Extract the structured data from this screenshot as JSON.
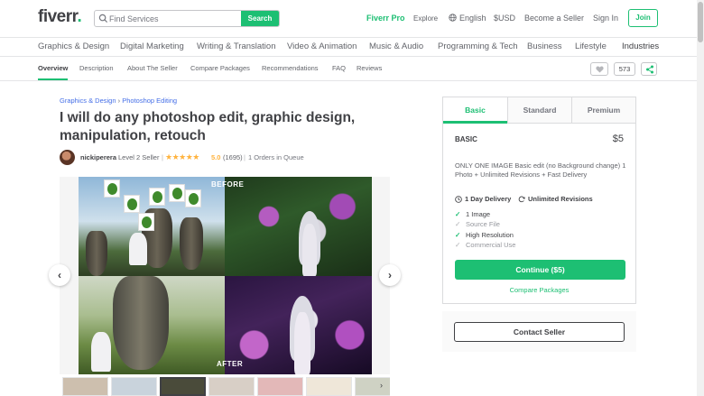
{
  "header": {
    "logo": "fiverr",
    "logo_dot": ".",
    "search_placeholder": "Find Services",
    "search_button": "Search",
    "fiverr_pro": "Fiverr Pro",
    "explore": "Explore",
    "language": "English",
    "currency": "$USD",
    "become_seller": "Become a Seller",
    "sign_in": "Sign In",
    "join": "Join"
  },
  "categories": [
    "Graphics & Design",
    "Digital Marketing",
    "Writing & Translation",
    "Video & Animation",
    "Music & Audio",
    "Programming & Tech",
    "Business",
    "Lifestyle",
    "Industries"
  ],
  "subnav": {
    "items": [
      "Overview",
      "Description",
      "About The Seller",
      "Compare Packages",
      "Recommendations",
      "FAQ",
      "Reviews"
    ],
    "likes": "573"
  },
  "gig": {
    "breadcrumb": [
      "Graphics & Design",
      "Photoshop Editing"
    ],
    "breadcrumb_sep": "›",
    "title": "I will do any photoshop edit, graphic design, manipulation, retouch",
    "seller_name": "nickiperera",
    "seller_level": "Level 2 Seller",
    "stars": "★★★★★",
    "rating": "5.0",
    "reviews": "(1695)",
    "queue": "1 Orders in Queue",
    "label_before": "BEFORE",
    "label_after": "AFTER",
    "arrow_prev": "‹",
    "arrow_next": "›"
  },
  "package": {
    "tabs": [
      "Basic",
      "Standard",
      "Premium"
    ],
    "name": "BASIC",
    "price": "$5",
    "description": "ONLY ONE IMAGE Basic edit (no Background change) 1 Photo + Unlimited Revisions + Fast Delivery",
    "delivery": "1 Day Delivery",
    "revisions": "Unlimited Revisions",
    "features": [
      {
        "label": "1 Image",
        "included": true
      },
      {
        "label": "Source File",
        "included": false
      },
      {
        "label": "High Resolution",
        "included": true
      },
      {
        "label": "Commercial Use",
        "included": false
      }
    ],
    "continue_button": "Continue ($5)",
    "compare_link": "Compare Packages",
    "contact_button": "Contact Seller"
  },
  "colors": {
    "brand_green": "#1dbf73",
    "star": "#ffb33e",
    "link_blue": "#446ee7"
  }
}
